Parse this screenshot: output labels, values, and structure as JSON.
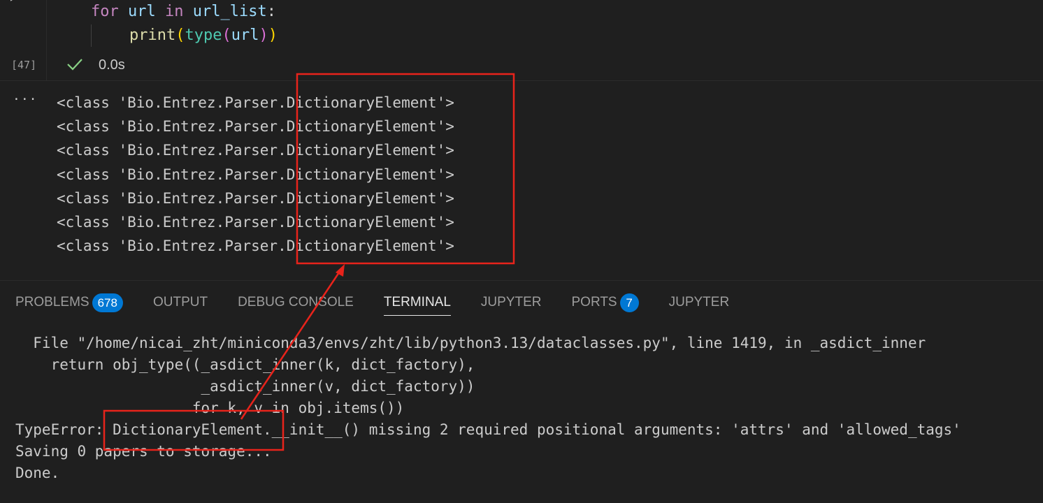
{
  "cell": {
    "run_icon": "run-cell-icon",
    "code_line_1": {
      "kw": "for",
      "sp1": " ",
      "var": "url",
      "sp2": " ",
      "kw2": "in",
      "sp3": " ",
      "iter": "url_list",
      "colon": ":"
    },
    "code_line_2": {
      "fn": "print",
      "open1": "(",
      "builtin": "type",
      "open2": "(",
      "arg": "url",
      "close2": ")",
      "close1": ")"
    },
    "execution_count": "[47]",
    "status_icon": "check-icon",
    "status_color": "#89d185",
    "exec_time": "0.0s"
  },
  "output": {
    "more_glyph": "···",
    "lines": [
      "<class 'Bio.Entrez.Parser.DictionaryElement'>",
      "<class 'Bio.Entrez.Parser.DictionaryElement'>",
      "<class 'Bio.Entrez.Parser.DictionaryElement'>",
      "<class 'Bio.Entrez.Parser.DictionaryElement'>",
      "<class 'Bio.Entrez.Parser.DictionaryElement'>",
      "<class 'Bio.Entrez.Parser.DictionaryElement'>",
      "<class 'Bio.Entrez.Parser.DictionaryElement'>"
    ]
  },
  "panel": {
    "tabs": [
      {
        "label": "PROBLEMS",
        "badge": "678",
        "active": false
      },
      {
        "label": "OUTPUT",
        "badge": "",
        "active": false
      },
      {
        "label": "DEBUG CONSOLE",
        "badge": "",
        "active": false
      },
      {
        "label": "TERMINAL",
        "badge": "",
        "active": true
      },
      {
        "label": "JUPYTER",
        "badge": "",
        "active": false
      },
      {
        "label": "PORTS",
        "badge": "7",
        "active": false
      },
      {
        "label": "JUPYTER",
        "badge": "",
        "active": false
      }
    ],
    "badge_color": "#0078d4"
  },
  "terminal": {
    "lines": [
      "  File \"/home/nicai_zht/miniconda3/envs/zht/lib/python3.13/dataclasses.py\", line 1419, in _asdict_inner",
      "    return obj_type((_asdict_inner(k, dict_factory),",
      "                     _asdict_inner(v, dict_factory))",
      "                    for k, v in obj.items())",
      "TypeError: DictionaryElement.__init__() missing 2 required positional arguments: 'attrs' and 'allowed_tags'",
      "Saving 0 papers to storage...",
      "Done."
    ]
  },
  "annotations": {
    "color": "#e8231b"
  }
}
